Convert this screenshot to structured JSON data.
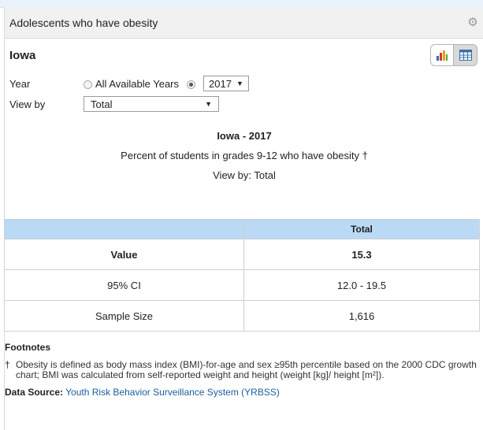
{
  "panel": {
    "title": "Adolescents who have obesity",
    "state": "Iowa"
  },
  "form": {
    "year_label": "Year",
    "all_years_label": "All Available Years",
    "year_value": "2017",
    "viewby_label": "View by",
    "viewby_value": "Total"
  },
  "titles": {
    "line1": "Iowa - 2017",
    "line2": "Percent of students in grades 9-12 who have obesity †",
    "line3": "View by: Total"
  },
  "table": {
    "header_blank": "",
    "header_total": "Total",
    "rows": [
      {
        "label": "Value",
        "value": "15.3"
      },
      {
        "label": "95% CI",
        "value": "12.0 - 19.5"
      },
      {
        "label": "Sample Size",
        "value": "1,616"
      }
    ]
  },
  "footnotes": {
    "title": "Footnotes",
    "mark": "†",
    "text": "Obesity is defined as body mass index (BMI)-for-age and sex ≥95th percentile based on the 2000 CDC growth chart; BMI was calculated from self-reported weight and height (weight [kg]/ height [m²]).",
    "source_label": "Data Source:",
    "source_link": "Youth Risk Behavior Surveillance System (YRBSS)"
  },
  "colors": {
    "header_bg": "#f1f1f1",
    "table_header_bg": "#b9d9f5",
    "link": "#1b5e9c"
  },
  "icons": [
    "gear-icon",
    "bar-chart-icon",
    "table-icon",
    "chevron-down-icon",
    "radio-icon"
  ]
}
